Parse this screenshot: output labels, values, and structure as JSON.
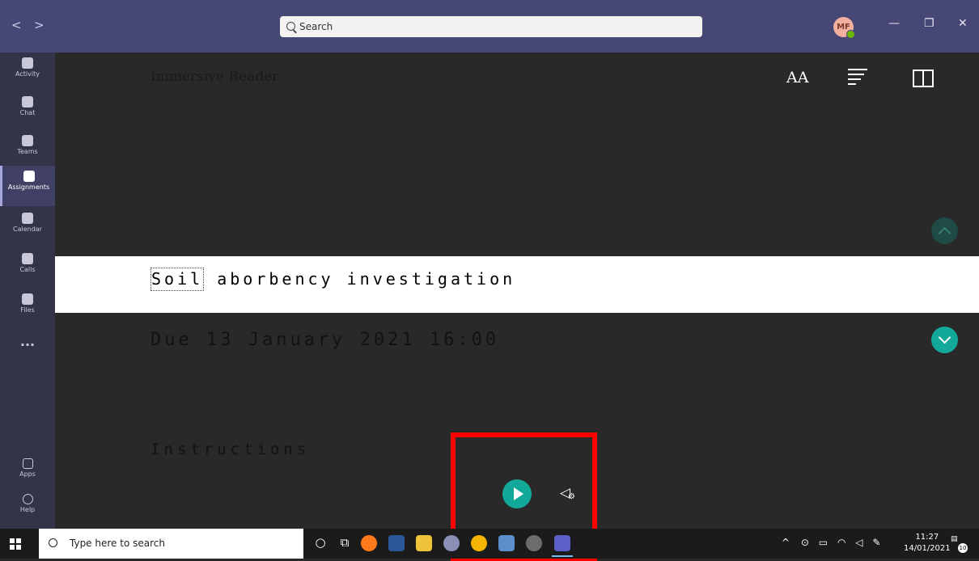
{
  "window": {
    "search_placeholder": "Search",
    "avatar_initials": "MF",
    "controls": {
      "minimize": "—",
      "maximize": "❐",
      "close": "✕"
    },
    "nav": {
      "back": "<",
      "forward": ">"
    }
  },
  "rail": {
    "items": [
      {
        "label": "Activity",
        "icon": "bell-icon"
      },
      {
        "label": "Chat",
        "icon": "chat-icon"
      },
      {
        "label": "Teams",
        "icon": "teams-icon"
      },
      {
        "label": "Assignments",
        "icon": "assignments-icon",
        "active": true
      },
      {
        "label": "Calendar",
        "icon": "calendar-icon"
      },
      {
        "label": "Calls",
        "icon": "phone-icon"
      },
      {
        "label": "Files",
        "icon": "file-icon"
      }
    ],
    "more": "...",
    "apps_label": "Apps",
    "help_label": "Help"
  },
  "reader": {
    "title": "Immersive Reader",
    "text_prefs_icon": "AA",
    "line_focus_word": "Soil",
    "line_rest": " aborbency investigation",
    "due": "Due 13 January 2021 16:00",
    "instructions": "Instructions"
  },
  "taskbar": {
    "search_placeholder": "Type here to search",
    "time": "11:27",
    "date": "14/01/2021",
    "notification_count": "10",
    "tray_chevron": "^",
    "accent": "#76b9ed"
  },
  "colors": {
    "teams_purple": "#464775",
    "teal_accent": "#13a99a",
    "highlight_red": "#ff0000"
  }
}
